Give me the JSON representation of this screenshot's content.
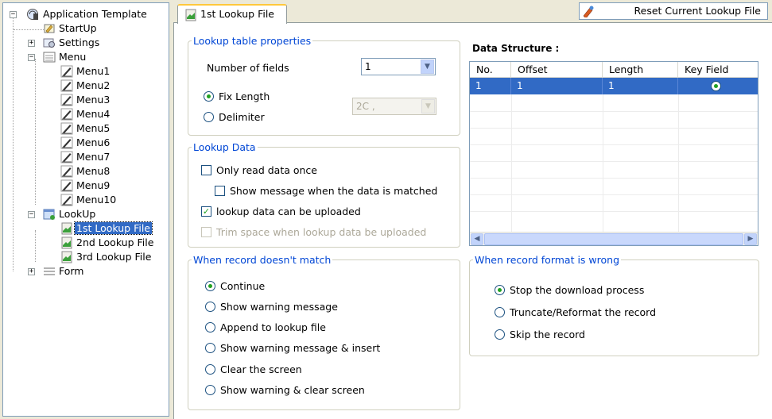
{
  "tree": {
    "root": "Application Template",
    "startup": "StartUp",
    "settings": "Settings",
    "menu": "Menu",
    "menu_items": [
      "Menu1",
      "Menu2",
      "Menu3",
      "Menu4",
      "Menu5",
      "Menu6",
      "Menu7",
      "Menu8",
      "Menu9",
      "Menu10"
    ],
    "lookup": "LookUp",
    "lookup_items": [
      "1st Lookup File",
      "2nd Lookup File",
      "3rd Lookup File"
    ],
    "form": "Form"
  },
  "tab": {
    "label": "1st Lookup File"
  },
  "toolbar": {
    "reset_label": "Reset Current Lookup File"
  },
  "lookup_props": {
    "legend": "Lookup table properties",
    "fields_label": "Number of fields",
    "fields_value": "1",
    "fix_length": "Fix Length",
    "delimiter": "Delimiter",
    "delimiter_value": "2C ,"
  },
  "lookup_data": {
    "legend": "Lookup Data",
    "read_once": "Only read data once",
    "show_message": "Show message when the data is matched",
    "can_upload": "lookup data can be uploaded",
    "trim_space": "Trim space when lookup data be uploaded"
  },
  "no_match": {
    "legend": "When record doesn't match",
    "options": [
      "Continue",
      "Show warning message",
      "Append to lookup file",
      "Show warning message & insert",
      "Clear the screen",
      "Show warning & clear screen"
    ],
    "selected": 0
  },
  "data_structure": {
    "title": "Data Structure :",
    "columns": [
      "No.",
      "Offset",
      "Length",
      "Key Field"
    ],
    "rows": [
      {
        "no": "1",
        "offset": "1",
        "length": "1",
        "key": true
      }
    ]
  },
  "format_wrong": {
    "legend": "When record format is wrong",
    "options": [
      "Stop the download process",
      "Truncate/Reformat the record",
      "Skip the record"
    ],
    "selected": 0
  },
  "colors": {
    "accent": "#316ac5",
    "legend": "#0046d5",
    "check": "#21a121"
  }
}
